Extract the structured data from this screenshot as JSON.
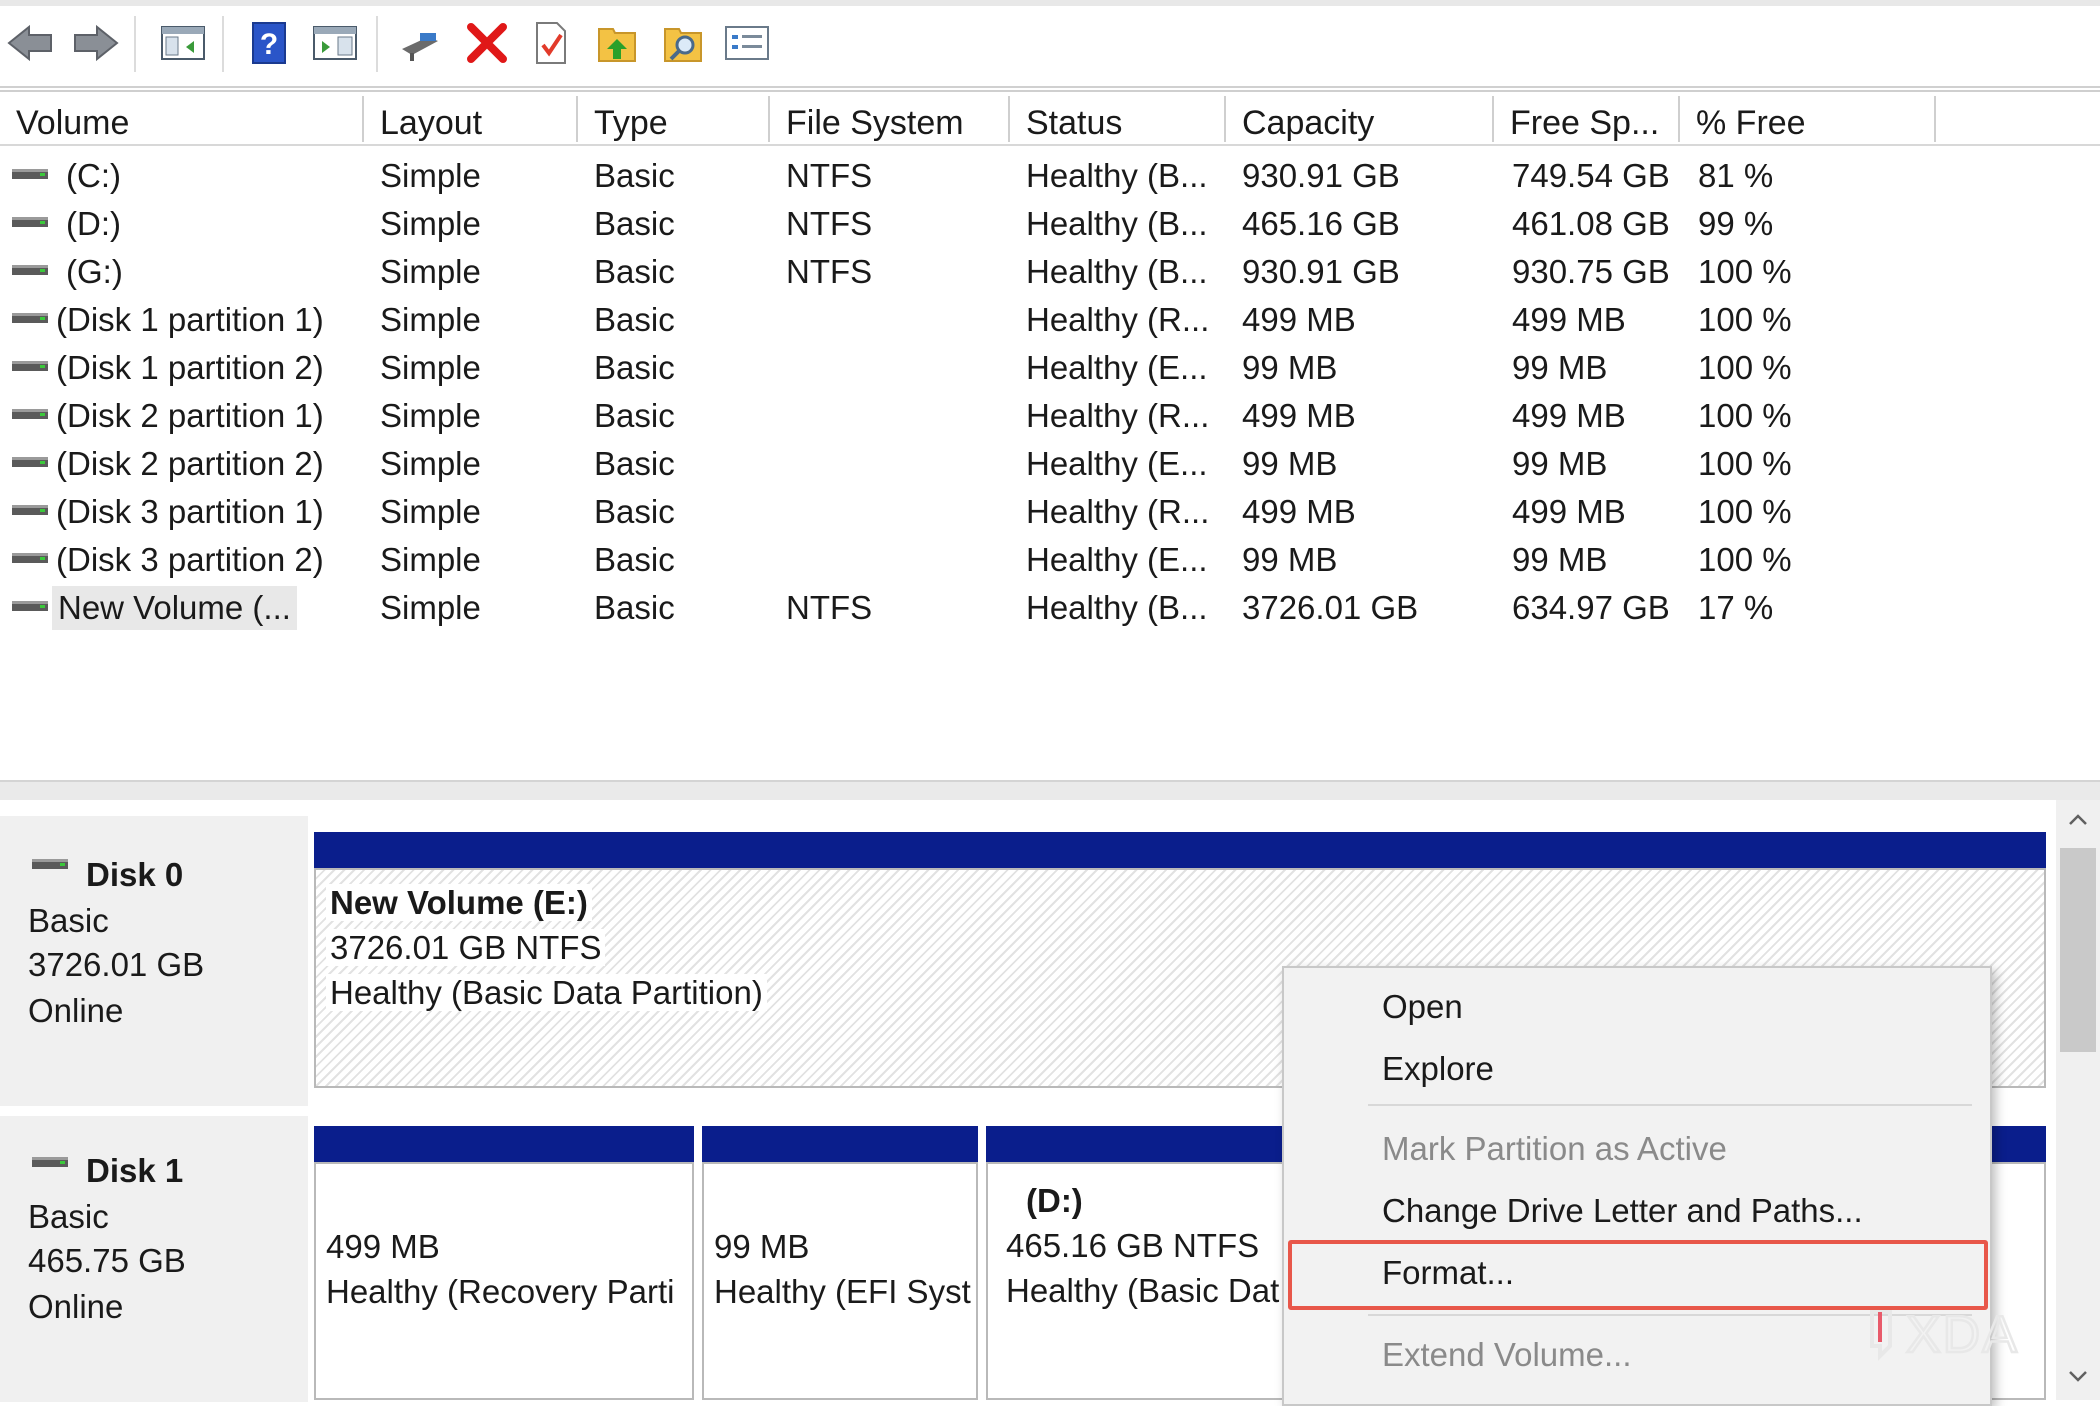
{
  "columns": [
    "Volume",
    "Layout",
    "Type",
    "File System",
    "Status",
    "Capacity",
    "Free Sp...",
    "% Free"
  ],
  "rows": [
    {
      "volume": "(C:)",
      "layout": "Simple",
      "type": "Basic",
      "fs": "NTFS",
      "status": "Healthy (B...",
      "capacity": "930.91 GB",
      "free": "749.54 GB",
      "pct": "81 %"
    },
    {
      "volume": "(D:)",
      "layout": "Simple",
      "type": "Basic",
      "fs": "NTFS",
      "status": "Healthy (B...",
      "capacity": "465.16 GB",
      "free": "461.08 GB",
      "pct": "99 %"
    },
    {
      "volume": "(G:)",
      "layout": "Simple",
      "type": "Basic",
      "fs": "NTFS",
      "status": "Healthy (B...",
      "capacity": "930.91 GB",
      "free": "930.75 GB",
      "pct": "100 %"
    },
    {
      "volume": "(Disk 1 partition 1)",
      "layout": "Simple",
      "type": "Basic",
      "fs": "",
      "status": "Healthy (R...",
      "capacity": "499 MB",
      "free": "499 MB",
      "pct": "100 %"
    },
    {
      "volume": "(Disk 1 partition 2)",
      "layout": "Simple",
      "type": "Basic",
      "fs": "",
      "status": "Healthy (E...",
      "capacity": "99 MB",
      "free": "99 MB",
      "pct": "100 %"
    },
    {
      "volume": "(Disk 2 partition 1)",
      "layout": "Simple",
      "type": "Basic",
      "fs": "",
      "status": "Healthy (R...",
      "capacity": "499 MB",
      "free": "499 MB",
      "pct": "100 %"
    },
    {
      "volume": "(Disk 2 partition 2)",
      "layout": "Simple",
      "type": "Basic",
      "fs": "",
      "status": "Healthy (E...",
      "capacity": "99 MB",
      "free": "99 MB",
      "pct": "100 %"
    },
    {
      "volume": "(Disk 3 partition 1)",
      "layout": "Simple",
      "type": "Basic",
      "fs": "",
      "status": "Healthy (R...",
      "capacity": "499 MB",
      "free": "499 MB",
      "pct": "100 %"
    },
    {
      "volume": "(Disk 3 partition 2)",
      "layout": "Simple",
      "type": "Basic",
      "fs": "",
      "status": "Healthy (E...",
      "capacity": "99 MB",
      "free": "99 MB",
      "pct": "100 %"
    },
    {
      "volume": "New Volume (...",
      "layout": "Simple",
      "type": "Basic",
      "fs": "NTFS",
      "status": "Healthy (B...",
      "capacity": "3726.01 GB",
      "free": "634.97 GB",
      "pct": "17 %"
    }
  ],
  "disk0": {
    "name": "Disk 0",
    "type": "Basic",
    "size": "3726.01 GB",
    "state": "Online",
    "volume": {
      "title": "New Volume  (E:)",
      "line1": "3726.01 GB NTFS",
      "line2": "Healthy (Basic Data Partition)"
    }
  },
  "disk1": {
    "name": "Disk 1",
    "type": "Basic",
    "size": "465.75 GB",
    "state": "Online",
    "p1": {
      "line1": "499 MB",
      "line2": "Healthy (Recovery Parti"
    },
    "p2": {
      "line1": "99 MB",
      "line2": "Healthy (EFI Syst"
    },
    "p3": {
      "title": "(D:)",
      "line1": "465.16 GB NTFS",
      "line2": "Healthy (Basic Dat"
    }
  },
  "context_menu": {
    "items": [
      "Open",
      "Explore",
      "Mark Partition as Active",
      "Change Drive Letter and Paths...",
      "Format...",
      "Extend Volume..."
    ],
    "disabled": [
      "Mark Partition as Active",
      "Extend Volume..."
    ],
    "highlighted": "Format..."
  },
  "watermark": "XDA",
  "colors": {
    "volume_bar": "#0a1e8c",
    "highlight_box": "#e8574a"
  }
}
